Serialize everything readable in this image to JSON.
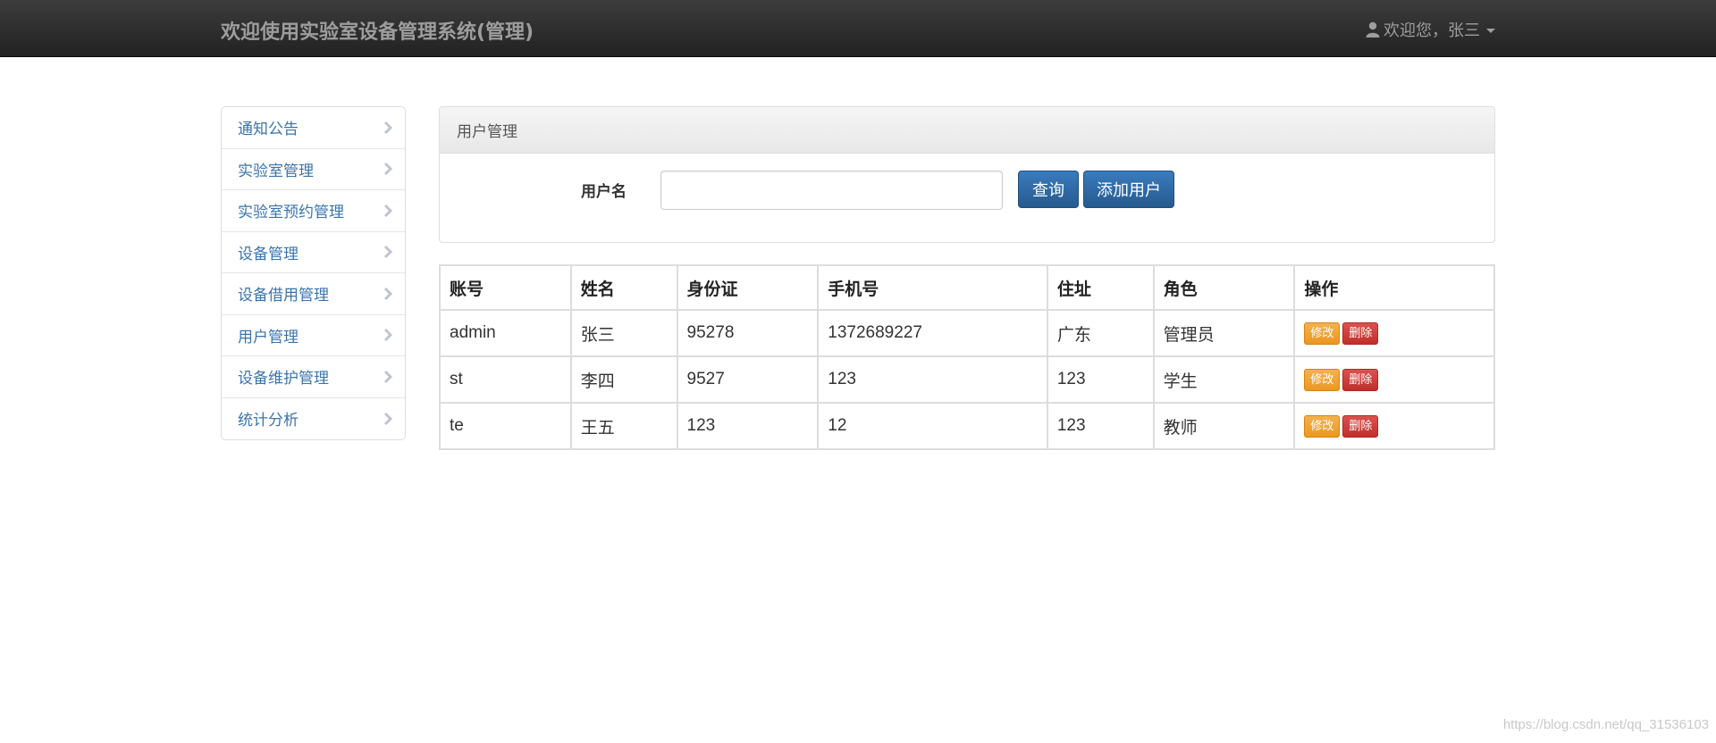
{
  "header": {
    "brand": "欢迎使用实验室设备管理系统(管理)",
    "user_greeting": "欢迎您，张三",
    "user_icon": "user-icon"
  },
  "sidebar": {
    "items": [
      {
        "label": "通知公告"
      },
      {
        "label": "实验室管理"
      },
      {
        "label": "实验室预约管理"
      },
      {
        "label": "设备管理"
      },
      {
        "label": "设备借用管理"
      },
      {
        "label": "用户管理"
      },
      {
        "label": "设备维护管理"
      },
      {
        "label": "统计分析"
      }
    ]
  },
  "panel": {
    "title": "用户管理",
    "search_label": "用户名",
    "search_value": "",
    "search_placeholder": "",
    "query_button": "查询",
    "add_button": "添加用户"
  },
  "table": {
    "headers": [
      "账号",
      "姓名",
      "身份证",
      "手机号",
      "住址",
      "角色",
      "操作"
    ],
    "rows": [
      {
        "account": "admin",
        "name": "张三",
        "id_card": "95278",
        "phone": "1372689227",
        "address": "广东",
        "role": "管理员",
        "edit": "修改",
        "delete": "删除"
      },
      {
        "account": "st",
        "name": "李四",
        "id_card": "9527",
        "phone": "123",
        "address": "123",
        "role": "学生",
        "edit": "修改",
        "delete": "删除"
      },
      {
        "account": "te",
        "name": "王五",
        "id_card": "123",
        "phone": "12",
        "address": "123",
        "role": "教师",
        "edit": "修改",
        "delete": "删除"
      }
    ]
  },
  "watermark": "https://blog.csdn.net/qq_31536103",
  "colors": {
    "navbar": "#222222",
    "link": "#3a74ad",
    "primary": "#286090",
    "warning": "#ec971f",
    "danger": "#d9534f"
  }
}
